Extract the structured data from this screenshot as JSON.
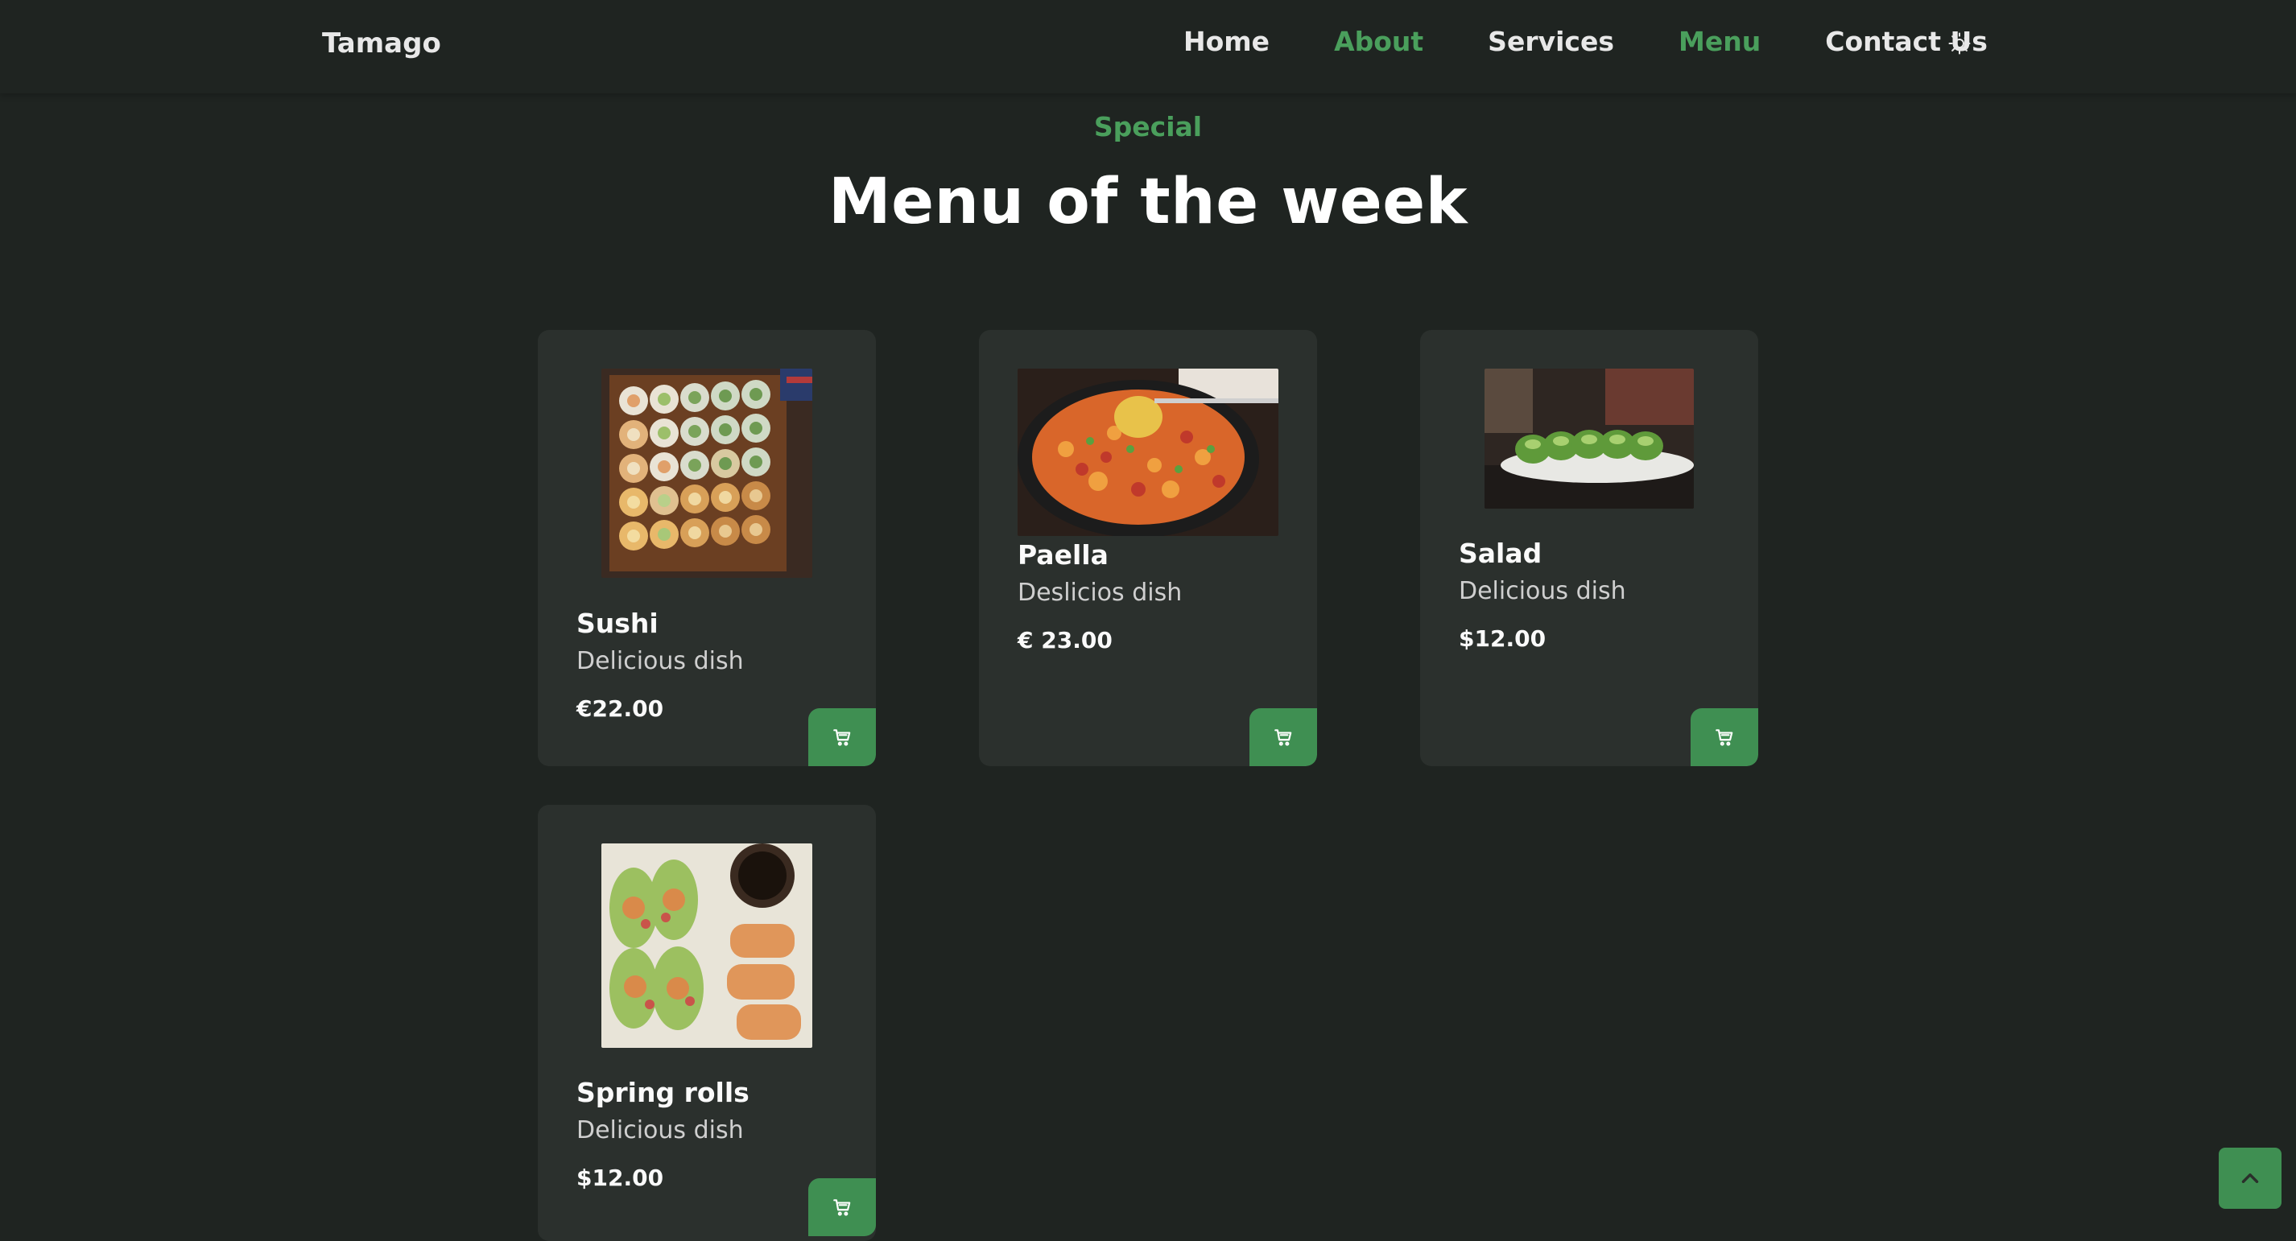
{
  "header": {
    "logo": "Tamago",
    "nav": [
      {
        "label": "Home",
        "active": false
      },
      {
        "label": "About",
        "active": true
      },
      {
        "label": "Services",
        "active": false
      },
      {
        "label": "Menu",
        "active": true
      },
      {
        "label": "Contact Us",
        "active": false
      }
    ],
    "theme_icon": "sun-icon"
  },
  "section": {
    "subtitle": "Special",
    "title": "Menu of the week"
  },
  "menu": {
    "items": [
      {
        "name": "Sushi",
        "description": "Delicious dish",
        "price": "€22.00",
        "image": "sushi-platter"
      },
      {
        "name": "Paella",
        "description": "Deslicios dish",
        "price": "€ 23.00",
        "image": "paella-pan"
      },
      {
        "name": "Salad",
        "description": "Delicious dish",
        "price": "$12.00",
        "image": "green-roll-plate"
      },
      {
        "name": "Spring rolls",
        "description": "Delicious dish",
        "price": "$12.00",
        "image": "spring-rolls"
      }
    ],
    "cart_icon": "cart-icon"
  },
  "scroll_top_icon": "chevron-up-icon",
  "colors": {
    "background": "#1f2421",
    "card": "#2b302d",
    "accent": "#4a9f5c",
    "button": "#3f8f52"
  }
}
